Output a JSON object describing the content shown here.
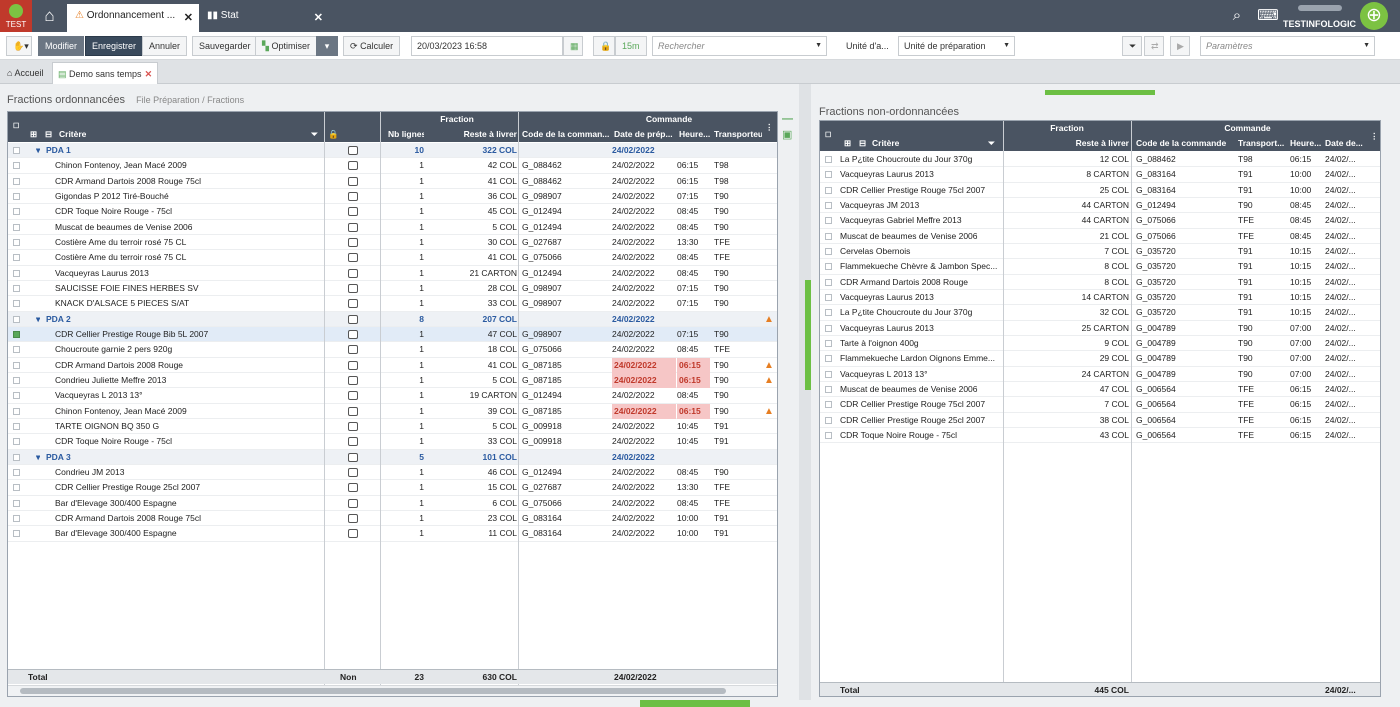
{
  "app": {
    "logo_label": "TEST",
    "user_name": "TESTINFOLOGIC"
  },
  "tabs": [
    {
      "label": "Ordonnancement ...",
      "close": "✕"
    },
    {
      "label": "Stat",
      "close": "✕"
    }
  ],
  "toolbar": {
    "modifier": "Modifier",
    "enregistrer": "Enregistrer",
    "annuler": "Annuler",
    "sauvegarder": "Sauvegarder",
    "optimiser": "Optimiser",
    "calculer": "Calculer",
    "date_value": "20/03/2023 16:58",
    "interval": "15m",
    "search_placeholder": "Rechercher",
    "unit_label": "Unité d'a...",
    "unit_value": "Unité de préparation",
    "params_placeholder": "Paramètres"
  },
  "nav": {
    "home": "Accueil",
    "current": "Demo sans temps"
  },
  "left": {
    "title": "Fractions ordonnancées",
    "breadcrumb": [
      "File Préparation",
      "Fractions"
    ],
    "group_headers": {
      "fraction": "Fraction",
      "commande": "Commande"
    },
    "columns": {
      "critere": "Critère",
      "nb_lignes": "Nb lignes",
      "reste": "Reste à livrer",
      "code": "Code de la comman...",
      "date": "Date de prép...",
      "heure": "Heure...",
      "transport": "Transporteu"
    },
    "rows": [
      {
        "g": 1,
        "name": "PDA 1",
        "nb": "10",
        "reste": "322 COL",
        "date": "24/02/2022"
      },
      {
        "name": "Chinon Fontenoy, Jean Macé 2009",
        "nb": "1",
        "reste": "42 COL",
        "code": "G_088462",
        "date": "24/02/2022",
        "heure": "06:15",
        "tr": "T98"
      },
      {
        "name": "CDR Armand Dartois 2008 Rouge 75cl",
        "nb": "1",
        "reste": "41 COL",
        "code": "G_088462",
        "date": "24/02/2022",
        "heure": "06:15",
        "tr": "T98"
      },
      {
        "name": "Gigondas P 2012 Tiré-Bouché",
        "nb": "1",
        "reste": "36 COL",
        "code": "G_098907",
        "date": "24/02/2022",
        "heure": "07:15",
        "tr": "T90"
      },
      {
        "name": "CDR Toque Noire Rouge - 75cl",
        "nb": "1",
        "reste": "45 COL",
        "code": "G_012494",
        "date": "24/02/2022",
        "heure": "08:45",
        "tr": "T90"
      },
      {
        "name": "Muscat de beaumes de Venise 2006",
        "nb": "1",
        "reste": "5 COL",
        "code": "G_012494",
        "date": "24/02/2022",
        "heure": "08:45",
        "tr": "T90"
      },
      {
        "name": "Costière Ame du terroir rosé 75 CL",
        "nb": "1",
        "reste": "30 COL",
        "code": "G_027687",
        "date": "24/02/2022",
        "heure": "13:30",
        "tr": "TFE"
      },
      {
        "name": "Costière Ame du terroir rosé 75 CL",
        "nb": "1",
        "reste": "41 COL",
        "code": "G_075066",
        "date": "24/02/2022",
        "heure": "08:45",
        "tr": "TFE"
      },
      {
        "name": "Vacqueyras Laurus 2013",
        "nb": "1",
        "reste": "21 CARTON",
        "code": "G_012494",
        "date": "24/02/2022",
        "heure": "08:45",
        "tr": "T90"
      },
      {
        "name": "SAUCISSE FOIE FINES HERBES SV",
        "nb": "1",
        "reste": "28 COL",
        "code": "G_098907",
        "date": "24/02/2022",
        "heure": "07:15",
        "tr": "T90"
      },
      {
        "name": "KNACK D'ALSACE 5 PIECES S/AT",
        "nb": "1",
        "reste": "33 COL",
        "code": "G_098907",
        "date": "24/02/2022",
        "heure": "07:15",
        "tr": "T90"
      },
      {
        "g": 1,
        "name": "PDA 2",
        "nb": "8",
        "reste": "207 COL",
        "date": "24/02/2022",
        "warn": 1
      },
      {
        "name": "CDR Cellier Prestige Rouge Bib 5L 2007",
        "nb": "1",
        "reste": "47 COL",
        "code": "G_098907",
        "date": "24/02/2022",
        "heure": "07:15",
        "tr": "T90",
        "sel": 1
      },
      {
        "name": "Choucroute garnie 2 pers 920g",
        "nb": "1",
        "reste": "18 COL",
        "code": "G_075066",
        "date": "24/02/2022",
        "heure": "08:45",
        "tr": "TFE"
      },
      {
        "name": "CDR Armand Dartois 2008 Rouge",
        "nb": "1",
        "reste": "41 COL",
        "code": "G_087185",
        "date": "24/02/2022",
        "heure": "06:15",
        "tr": "T90",
        "red": 1,
        "warn": 1
      },
      {
        "name": "Condrieu Juliette Meffre 2013",
        "nb": "1",
        "reste": "5 COL",
        "code": "G_087185",
        "date": "24/02/2022",
        "heure": "06:15",
        "tr": "T90",
        "red": 1,
        "warn": 1
      },
      {
        "name": "Vacqueyras L 2013 13°",
        "nb": "1",
        "reste": "19 CARTON",
        "code": "G_012494",
        "date": "24/02/2022",
        "heure": "08:45",
        "tr": "T90"
      },
      {
        "name": "Chinon Fontenoy, Jean Macé 2009",
        "nb": "1",
        "reste": "39 COL",
        "code": "G_087185",
        "date": "24/02/2022",
        "heure": "06:15",
        "tr": "T90",
        "red": 1,
        "warn": 1
      },
      {
        "name": "TARTE OIGNON BQ 350 G",
        "nb": "1",
        "reste": "5 COL",
        "code": "G_009918",
        "date": "24/02/2022",
        "heure": "10:45",
        "tr": "T91"
      },
      {
        "name": "CDR Toque Noire Rouge - 75cl",
        "nb": "1",
        "reste": "33 COL",
        "code": "G_009918",
        "date": "24/02/2022",
        "heure": "10:45",
        "tr": "T91"
      },
      {
        "g": 1,
        "name": "PDA 3",
        "nb": "5",
        "reste": "101 COL",
        "date": "24/02/2022"
      },
      {
        "name": "Condrieu JM 2013",
        "nb": "1",
        "reste": "46 COL",
        "code": "G_012494",
        "date": "24/02/2022",
        "heure": "08:45",
        "tr": "T90"
      },
      {
        "name": "CDR Cellier Prestige Rouge 25cl 2007",
        "nb": "1",
        "reste": "15 COL",
        "code": "G_027687",
        "date": "24/02/2022",
        "heure": "13:30",
        "tr": "TFE"
      },
      {
        "name": "Bar d'Elevage 300/400 Espagne",
        "nb": "1",
        "reste": "6 COL",
        "code": "G_075066",
        "date": "24/02/2022",
        "heure": "08:45",
        "tr": "TFE"
      },
      {
        "name": "CDR Armand Dartois 2008 Rouge 75cl",
        "nb": "1",
        "reste": "23 COL",
        "code": "G_083164",
        "date": "24/02/2022",
        "heure": "10:00",
        "tr": "T91"
      },
      {
        "name": "Bar d'Elevage 300/400 Espagne",
        "nb": "1",
        "reste": "11 COL",
        "code": "G_083164",
        "date": "24/02/2022",
        "heure": "10:00",
        "tr": "T91"
      }
    ],
    "footer": {
      "label": "Total",
      "lock": "Non",
      "nb": "23",
      "reste": "630 COL",
      "date": "24/02/2022"
    }
  },
  "right": {
    "title": "Fractions non-ordonnancées",
    "group_headers": {
      "fraction": "Fraction",
      "commande": "Commande"
    },
    "columns": {
      "critere": "Critère",
      "reste": "Reste à livrer",
      "code": "Code de la commande",
      "transport": "Transport...",
      "heure": "Heure...",
      "date": "Date de..."
    },
    "rows": [
      {
        "name": "La P¿tite Choucroute du Jour 370g",
        "reste": "12 COL",
        "code": "G_088462",
        "tr": "T98",
        "heure": "06:15",
        "date": "24/02/..."
      },
      {
        "name": "Vacqueyras Laurus 2013",
        "reste": "8 CARTON",
        "code": "G_083164",
        "tr": "T91",
        "heure": "10:00",
        "date": "24/02/..."
      },
      {
        "name": "CDR Cellier Prestige Rouge 75cl 2007",
        "reste": "25 COL",
        "code": "G_083164",
        "tr": "T91",
        "heure": "10:00",
        "date": "24/02/..."
      },
      {
        "name": "Vacqueyras JM 2013",
        "reste": "44 CARTON",
        "code": "G_012494",
        "tr": "T90",
        "heure": "08:45",
        "date": "24/02/..."
      },
      {
        "name": "Vacqueyras Gabriel Meffre 2013",
        "reste": "44 CARTON",
        "code": "G_075066",
        "tr": "TFE",
        "heure": "08:45",
        "date": "24/02/..."
      },
      {
        "name": "Muscat de beaumes de Venise 2006",
        "reste": "21 COL",
        "code": "G_075066",
        "tr": "TFE",
        "heure": "08:45",
        "date": "24/02/..."
      },
      {
        "name": "Cervelas Obernois",
        "reste": "7 COL",
        "code": "G_035720",
        "tr": "T91",
        "heure": "10:15",
        "date": "24/02/..."
      },
      {
        "name": "Flammekueche Chèvre & Jambon Spec...",
        "reste": "8 COL",
        "code": "G_035720",
        "tr": "T91",
        "heure": "10:15",
        "date": "24/02/..."
      },
      {
        "name": "CDR Armand Dartois 2008 Rouge",
        "reste": "8 COL",
        "code": "G_035720",
        "tr": "T91",
        "heure": "10:15",
        "date": "24/02/..."
      },
      {
        "name": "Vacqueyras Laurus 2013",
        "reste": "14 CARTON",
        "code": "G_035720",
        "tr": "T91",
        "heure": "10:15",
        "date": "24/02/..."
      },
      {
        "name": "La P¿tite Choucroute du Jour 370g",
        "reste": "32 COL",
        "code": "G_035720",
        "tr": "T91",
        "heure": "10:15",
        "date": "24/02/..."
      },
      {
        "name": "Vacqueyras Laurus 2013",
        "reste": "25 CARTON",
        "code": "G_004789",
        "tr": "T90",
        "heure": "07:00",
        "date": "24/02/..."
      },
      {
        "name": "Tarte à l'oignon 400g",
        "reste": "9 COL",
        "code": "G_004789",
        "tr": "T90",
        "heure": "07:00",
        "date": "24/02/..."
      },
      {
        "name": "Flammekueche Lardon Oignons Emme...",
        "reste": "29 COL",
        "code": "G_004789",
        "tr": "T90",
        "heure": "07:00",
        "date": "24/02/..."
      },
      {
        "name": "Vacqueyras L 2013 13°",
        "reste": "24 CARTON",
        "code": "G_004789",
        "tr": "T90",
        "heure": "07:00",
        "date": "24/02/..."
      },
      {
        "name": "Muscat de beaumes de Venise 2006",
        "reste": "47 COL",
        "code": "G_006564",
        "tr": "TFE",
        "heure": "06:15",
        "date": "24/02/..."
      },
      {
        "name": "CDR Cellier Prestige Rouge 75cl 2007",
        "reste": "7 COL",
        "code": "G_006564",
        "tr": "TFE",
        "heure": "06:15",
        "date": "24/02/..."
      },
      {
        "name": "CDR Cellier Prestige Rouge 25cl 2007",
        "reste": "38 COL",
        "code": "G_006564",
        "tr": "TFE",
        "heure": "06:15",
        "date": "24/02/..."
      },
      {
        "name": "CDR Toque Noire Rouge - 75cl",
        "reste": "43 COL",
        "code": "G_006564",
        "tr": "TFE",
        "heure": "06:15",
        "date": "24/02/..."
      }
    ],
    "footer": {
      "label": "Total",
      "reste": "445 COL",
      "date": "24/02/..."
    }
  }
}
